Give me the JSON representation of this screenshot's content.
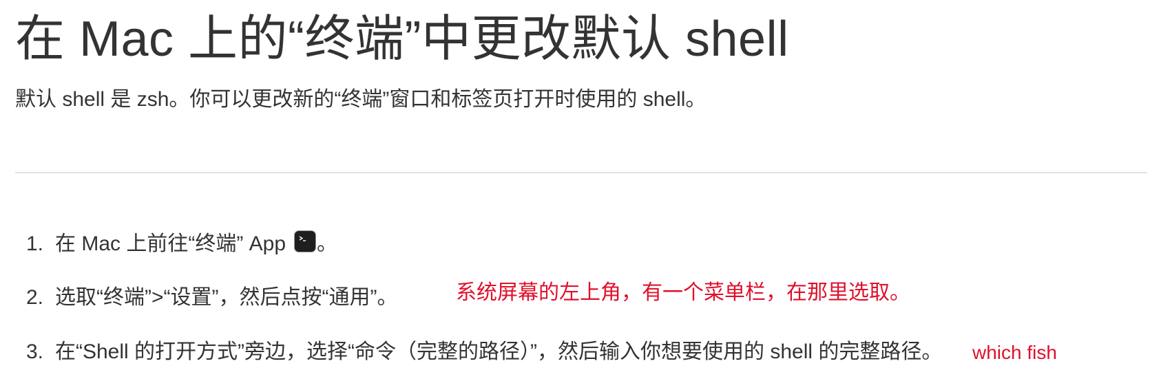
{
  "title": "在 Mac 上的“终端”中更改默认 shell",
  "intro": "默认 shell 是 zsh。你可以更改新的“终端”窗口和标签页打开时使用的 shell。",
  "steps": [
    {
      "num": "1.",
      "text": "在 Mac 上前往“终端” App",
      "after_icon": "。",
      "icon": "terminal-app-icon"
    },
    {
      "num": "2.",
      "text": "选取“终端”>“设置”，然后点按“通用”。"
    },
    {
      "num": "3.",
      "text": "在“Shell 的打开方式”旁边，选择“命令（完整的路径）”，然后输入你想要使用的 shell 的完整路径。"
    }
  ],
  "annotations": [
    {
      "text": "系统屏幕的左上角，有一个菜单栏，在那里选取。",
      "color": "#e0102c"
    },
    {
      "text": "which fish",
      "color": "#e0102c"
    }
  ],
  "colors": {
    "text": "#333333",
    "divider": "#e2e2e2",
    "annotation": "#e0102c"
  }
}
